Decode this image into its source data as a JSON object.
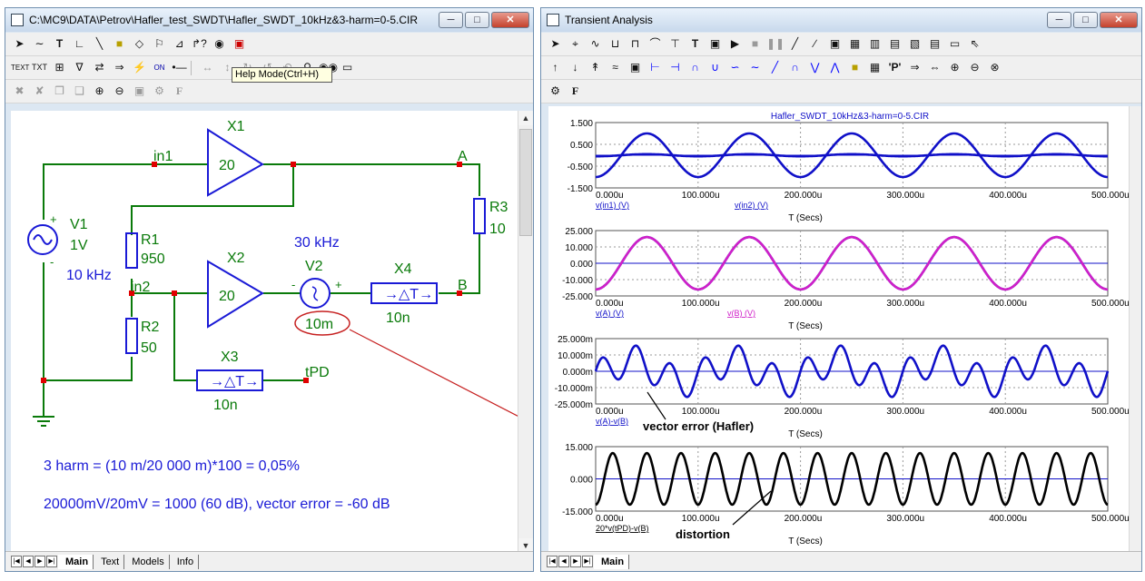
{
  "schematic": {
    "title": "C:\\MC9\\DATA\\Petrov\\Hafler_test_SWDT\\Hafler_SWDT_10kHz&3-harm=0-5.CIR",
    "tooltip": "Help Mode(Ctrl+H)",
    "tabs": [
      "Main",
      "Text",
      "Models",
      "Info"
    ],
    "components": {
      "x1_label": "X1",
      "x1_gain": "20",
      "x2_label": "X2",
      "x2_gain": "20",
      "x3_label": "X3",
      "x3_delay": "10n",
      "x3_symbol": "→△T→",
      "x4_label": "X4",
      "x4_delay": "10n",
      "x4_symbol": "→△T→",
      "r1_label": "R1",
      "r1_value": "950",
      "r2_label": "R2",
      "r2_value": "50",
      "r3_label": "R3",
      "r3_value": "10",
      "v1_label": "V1",
      "v1_value": "1V",
      "v1_freq": "10 kHz",
      "v2_label": "V2",
      "v2_value": "10m",
      "v2_freq": "30 kHz"
    },
    "nodes": {
      "in1": "in1",
      "in2": "in2",
      "a": "A",
      "b": "B",
      "tpd": "tPD",
      "plus1": "+",
      "minus1": "-",
      "minus2": "-",
      "plus2": "+"
    },
    "notes": {
      "line1": "3 harm = (10 m/20 000 m)*100 = 0,05%",
      "line2": "20000mV/20mV = 1000 (60 dB), vector error = -60 dB"
    },
    "colors": {
      "wire": "#0a7a0a",
      "component": "#1a1ad6",
      "text_blue": "#1a1ad6",
      "annotation_red": "#c62020",
      "node_red": "#e00000"
    }
  },
  "transient": {
    "title": "Transient Analysis",
    "tabs": [
      "Main"
    ],
    "plot_title": "Hafler_SWDT_10kHz&3-harm=0-5.CIR",
    "x_axis_label": "T (Secs)",
    "x_ticks": [
      "0.000u",
      "100.000u",
      "200.000u",
      "300.000u",
      "400.000u",
      "500.000u"
    ],
    "annotations": {
      "vector_error": "vector error (Hafler)",
      "distortion": "distortion"
    },
    "colors": {
      "blue": "#1010c8",
      "magenta": "#d020c8",
      "black": "#000000",
      "grid": "#9a9a9a",
      "axis": "#555555"
    }
  },
  "chart_data": [
    {
      "type": "line",
      "x_range": [
        "0.000u",
        "500.000u"
      ],
      "ylim": [
        -1.5,
        1.5
      ],
      "y_ticks": [
        "1.500",
        "0.500",
        "-0.500",
        "-1.500"
      ],
      "series": [
        {
          "name": "v(in1) (V)",
          "color": "#1010c8",
          "amplitude": 1.0,
          "frequency_khz": 10
        },
        {
          "name": "v(in2) (V)",
          "color": "#1010c8",
          "amplitude": 0.05,
          "frequency_khz": 10
        }
      ],
      "xlabel": "T (Secs)"
    },
    {
      "type": "line",
      "x_range": [
        "0.000u",
        "500.000u"
      ],
      "ylim": [
        -25,
        25
      ],
      "y_ticks": [
        "25.000",
        "10.000",
        "0.000",
        "-10.000",
        "-25.000"
      ],
      "series": [
        {
          "name": "v(A) (V)",
          "color": "#1010c8",
          "amplitude": 20,
          "frequency_khz": 10
        },
        {
          "name": "v(B) (V)",
          "color": "#d020c8",
          "amplitude": 20,
          "frequency_khz": 10
        }
      ],
      "xlabel": "T (Secs)"
    },
    {
      "type": "line",
      "x_range": [
        "0.000u",
        "500.000u"
      ],
      "ylim": [
        -25,
        25
      ],
      "y_ticks": [
        "25.000m",
        "10.000m",
        "0.000m",
        "-10.000m",
        "-25.000m"
      ],
      "series": [
        {
          "name": "v(A)-v(B)",
          "color": "#1010c8",
          "fund_amplitude": 8,
          "fund_frequency_khz": 10,
          "harm_amplitude": 12,
          "harm_frequency_khz": 30
        }
      ],
      "xlabel": "T (Secs)"
    },
    {
      "type": "line",
      "x_range": [
        "0.000u",
        "500.000u"
      ],
      "ylim": [
        -15,
        15
      ],
      "y_ticks": [
        "15.000",
        "0.000",
        "-15.000"
      ],
      "series": [
        {
          "name": "20*v(tPD)-v(B)",
          "color": "#000000",
          "amplitude": 12,
          "frequency_khz": 30
        }
      ],
      "xlabel": "T (Secs)"
    }
  ]
}
